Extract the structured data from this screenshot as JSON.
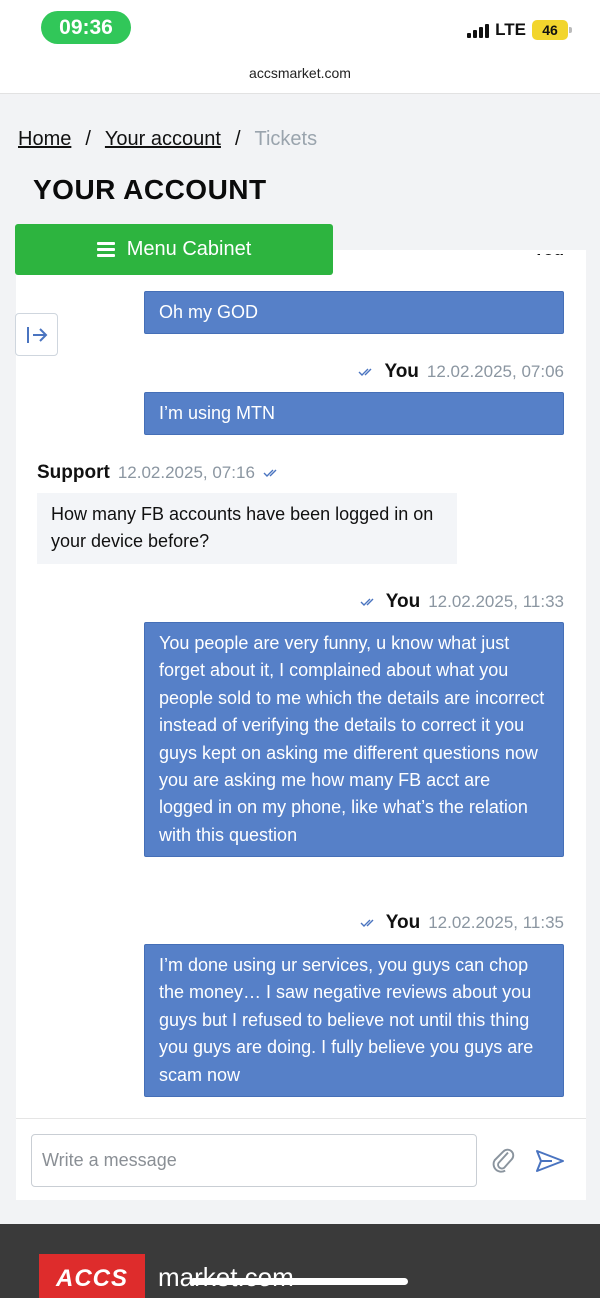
{
  "status_bar": {
    "time": "09:36",
    "network": "LTE",
    "battery": "46"
  },
  "browser": {
    "url": "accsmarket.com"
  },
  "breadcrumb": {
    "home": "Home",
    "account": "Your account",
    "separator": "/",
    "current": "Tickets"
  },
  "page": {
    "title": "YOUR ACCOUNT",
    "menu_button": "Menu Cabinet"
  },
  "chat": {
    "cut_author": "You",
    "messages": [
      {
        "author": "You",
        "time": "",
        "text": "Oh my GOD"
      },
      {
        "author": "You",
        "time": "12.02.2025, 07:06",
        "text": "I’m using MTN"
      },
      {
        "author": "Support",
        "time": "12.02.2025, 07:16",
        "text": "How many FB accounts have been logged in on your device before?"
      },
      {
        "author": "You",
        "time": "12.02.2025, 11:33",
        "text": "You people are very funny, u know what just forget about it, I complained about what you people sold to me which the details are incorrect instead of verifying the details to correct it you guys kept on asking me different questions now you are asking me how many FB acct are logged in on my phone, like what’s the relation with this question"
      },
      {
        "author": "You",
        "time": "12.02.2025, 11:35",
        "text": "I’m done using ur services, you guys can chop the money… I saw negative reviews about you guys but I refused to believe not until this thing you guys are doing. I fully believe you guys are scam now"
      }
    ]
  },
  "composer": {
    "placeholder": "Write a message"
  },
  "footer": {
    "logo_badge": "ACCS",
    "logo_text": "market.com"
  },
  "colors": {
    "green": "#2db43f",
    "bubble_blue": "#5680c8",
    "brand_red": "#de2c2c"
  }
}
